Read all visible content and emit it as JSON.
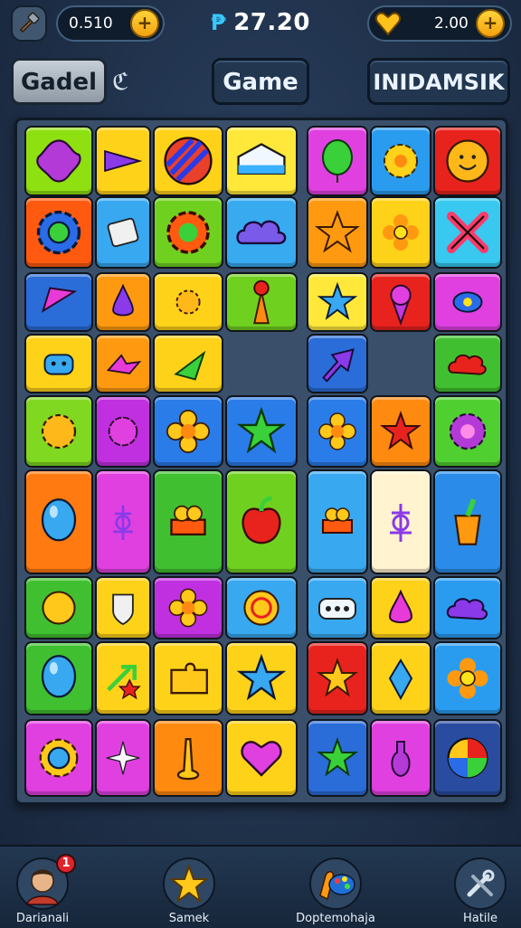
{
  "topbar": {
    "left_value": "0.510",
    "score_prefix": "₱",
    "score": "27.20",
    "right_value": "2.00",
    "plus_label": "+",
    "menu_icon": "hammer-icon",
    "coin_icon": "heart-gem-icon"
  },
  "title_row": {
    "left_button": "Gadel",
    "left_symbol": "ℭ",
    "center_button": "Game",
    "right_button": "INIDAMSIK"
  },
  "board": {
    "columns": 8,
    "tiles": [
      {
        "row": 1,
        "col": 1,
        "color": "#8fe010",
        "icon": "purple-blob-icon"
      },
      {
        "row": 1,
        "col": 2,
        "color": "#ffd21a",
        "icon": "purple-arrow-icon"
      },
      {
        "row": 1,
        "col": 3,
        "color": "#ffd21a",
        "icon": "striped-ball-icon"
      },
      {
        "row": 1,
        "col": 4,
        "color": "#ffe83a",
        "icon": "cake-slice-icon"
      },
      {
        "row": 1,
        "col": 5,
        "color": "#e040e0",
        "icon": "green-balloon-icon"
      },
      {
        "row": 1,
        "col": 6,
        "color": "#2a9cf0",
        "icon": "yellow-gear-icon"
      },
      {
        "row": 1,
        "col": 7,
        "color": "#e8231e",
        "icon": "smiley-flower-icon"
      },
      {
        "row": 2,
        "col": 1,
        "color": "#ff5a10",
        "icon": "blue-gear-icon"
      },
      {
        "row": 2,
        "col": 2,
        "color": "#38a8f0",
        "icon": "badge-icon"
      },
      {
        "row": 2,
        "col": 3,
        "color": "#70d020",
        "icon": "red-gear-icon"
      },
      {
        "row": 2,
        "col": 4,
        "color": "#38aaf0",
        "icon": "cloud-icon"
      },
      {
        "row": 2,
        "col": 5,
        "color": "#ff9a10",
        "icon": "orange-star-icon"
      },
      {
        "row": 2,
        "col": 6,
        "color": "#ffd21a",
        "icon": "orange-flower-icon"
      },
      {
        "row": 2,
        "col": 7,
        "color": "#38c8f0",
        "icon": "cross-icon"
      },
      {
        "row": 3,
        "col": 1,
        "color": "#2a6cd8",
        "icon": "pink-arrow-icon"
      },
      {
        "row": 3,
        "col": 2,
        "color": "#ff9a10",
        "icon": "drop-icon"
      },
      {
        "row": 3,
        "col": 3,
        "color": "#ffd21a",
        "icon": "splat-icon"
      },
      {
        "row": 3,
        "col": 4,
        "color": "#70d020",
        "icon": "torch-icon"
      },
      {
        "row": 3,
        "col": 5,
        "color": "#ffe83a",
        "icon": "blue-star-icon"
      },
      {
        "row": 3,
        "col": 6,
        "color": "#e8231e",
        "icon": "ice-cream-icon"
      },
      {
        "row": 3,
        "col": 7,
        "color": "#e040e0",
        "icon": "candy-icon"
      },
      {
        "row": 4,
        "col": 1,
        "color": "#ffd21a",
        "icon": "monster-icon"
      },
      {
        "row": 4,
        "col": 2,
        "color": "#ff9a10",
        "icon": "pink-bird-icon"
      },
      {
        "row": 4,
        "col": 3,
        "color": "#ffd21a",
        "icon": "green-arrow-icon"
      },
      {
        "row": 4,
        "col": 5,
        "color": "#2a6cd8",
        "icon": "purple-cursor-icon"
      },
      {
        "row": 4,
        "col": 7,
        "color": "#40c030",
        "icon": "red-cloud-icon"
      },
      {
        "row": 5,
        "col": 1,
        "color": "#80d820",
        "icon": "sun-icon"
      },
      {
        "row": 5,
        "col": 2,
        "color": "#c030e0",
        "icon": "purple-puff-icon"
      },
      {
        "row": 5,
        "col": 3,
        "color": "#2a7ce8",
        "icon": "yellow-flower-icon"
      },
      {
        "row": 5,
        "col": 4,
        "color": "#2a7ce8",
        "icon": "green-star-icon"
      },
      {
        "row": 5,
        "col": 5,
        "color": "#2a7ce8",
        "icon": "yellow-flower-icon"
      },
      {
        "row": 5,
        "col": 6,
        "color": "#ff8a10",
        "icon": "red-star-icon"
      },
      {
        "row": 5,
        "col": 7,
        "color": "#50d030",
        "icon": "purple-flower-icon"
      },
      {
        "row": 6,
        "col": 1,
        "color": "#ff7a10",
        "icon": "blue-balloon-icon"
      },
      {
        "row": 6,
        "col": 2,
        "color": "#e040e0",
        "icon": "symbol-icon"
      },
      {
        "row": 6,
        "col": 3,
        "color": "#40c030",
        "icon": "fruit-basket-icon"
      },
      {
        "row": 6,
        "col": 4,
        "color": "#70d020",
        "icon": "apple-icon"
      },
      {
        "row": 6,
        "col": 5,
        "color": "#38a8f0",
        "icon": "fruit-basket-icon"
      },
      {
        "row": 6,
        "col": 6,
        "color": "#fff3d0",
        "icon": "symbol-icon"
      },
      {
        "row": 6,
        "col": 7,
        "color": "#2a8ce8",
        "icon": "carrot-face-icon"
      },
      {
        "row": 7,
        "col": 1,
        "color": "#40c030",
        "icon": "orange-ball-icon"
      },
      {
        "row": 7,
        "col": 2,
        "color": "#ffd21a",
        "icon": "shield-icon"
      },
      {
        "row": 7,
        "col": 3,
        "color": "#c030e0",
        "icon": "yellow-flower-icon"
      },
      {
        "row": 7,
        "col": 4,
        "color": "#38a8f0",
        "icon": "swirl-icon"
      },
      {
        "row": 7,
        "col": 5,
        "color": "#38a8f0",
        "icon": "dots-icon"
      },
      {
        "row": 7,
        "col": 6,
        "color": "#ffd21a",
        "icon": "pink-drop-icon"
      },
      {
        "row": 7,
        "col": 7,
        "color": "#2a9cf0",
        "icon": "purple-cloud-icon"
      },
      {
        "row": 8,
        "col": 1,
        "color": "#40c030",
        "icon": "blue-balloon-icon"
      },
      {
        "row": 8,
        "col": 2,
        "color": "#ffd21a",
        "icon": "star-arrow-icon"
      },
      {
        "row": 8,
        "col": 3,
        "color": "#ffd21a",
        "icon": "yellow-puzzle-icon"
      },
      {
        "row": 8,
        "col": 4,
        "color": "#ffd21a",
        "icon": "blue-star-icon"
      },
      {
        "row": 8,
        "col": 5,
        "color": "#e8231e",
        "icon": "yellow-star-icon"
      },
      {
        "row": 8,
        "col": 6,
        "color": "#ffd21a",
        "icon": "blue-gem-icon"
      },
      {
        "row": 8,
        "col": 7,
        "color": "#2a9cf0",
        "icon": "orange-flower-icon"
      },
      {
        "row": 9,
        "col": 1,
        "color": "#e040e0",
        "icon": "blue-ring-icon"
      },
      {
        "row": 9,
        "col": 2,
        "color": "#e040e0",
        "icon": "sparkle-icon"
      },
      {
        "row": 9,
        "col": 3,
        "color": "#ff8a10",
        "icon": "drip-icon"
      },
      {
        "row": 9,
        "col": 4,
        "color": "#ffd21a",
        "icon": "pink-heart-icon"
      },
      {
        "row": 9,
        "col": 5,
        "color": "#2a6cd8",
        "icon": "green-splat-icon"
      },
      {
        "row": 9,
        "col": 6,
        "color": "#e040e0",
        "icon": "bottle-icon"
      },
      {
        "row": 9,
        "col": 7,
        "color": "#2a4ca0",
        "icon": "color-wheel-icon"
      }
    ]
  },
  "nav": {
    "items": [
      {
        "label": "Darianali",
        "icon": "avatar-icon",
        "badge": "1"
      },
      {
        "label": "Samek",
        "icon": "yellow-star-figure-icon"
      },
      {
        "label": "Doptemohaja",
        "icon": "paint-palette-icon"
      },
      {
        "label": "Hatile",
        "icon": "tools-icon"
      }
    ]
  }
}
